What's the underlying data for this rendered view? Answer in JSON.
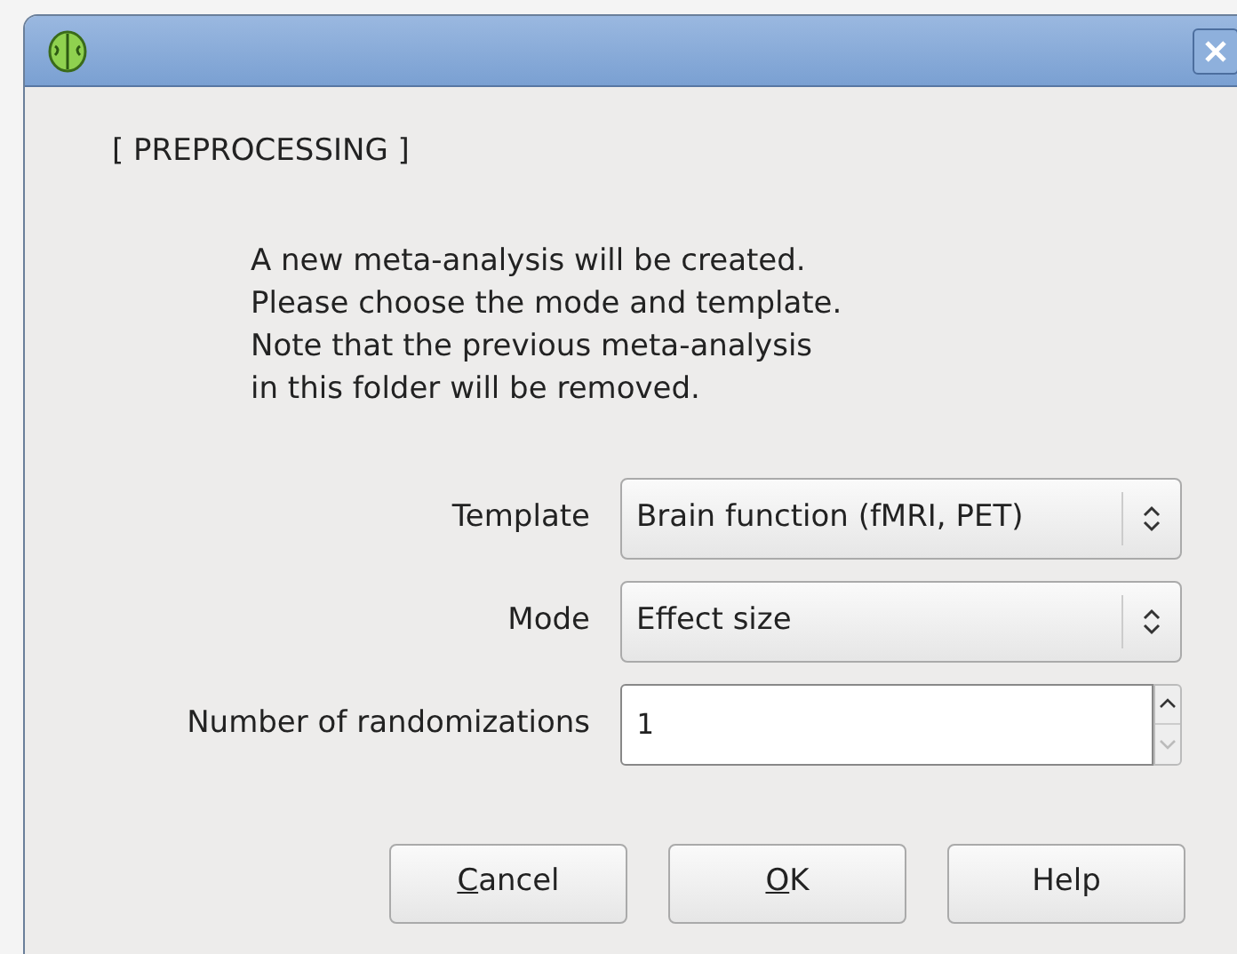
{
  "heading": "[ PREPROCESSING ]",
  "message": [
    "A new meta-analysis will be created.",
    "Please choose the mode and template.",
    "Note that the previous meta-analysis",
    "in this folder will be removed."
  ],
  "fields": [
    {
      "kind": "combo",
      "label": "Template",
      "value": "Brain function (fMRI, PET)"
    },
    {
      "kind": "combo",
      "label": "Mode",
      "value": "Effect size"
    },
    {
      "kind": "spin",
      "label": "Number of randomizations",
      "value": "1",
      "down_disabled": true
    }
  ],
  "buttons": [
    {
      "label": "Cancel",
      "underline_first": true
    },
    {
      "label": "OK",
      "underline_first": true
    },
    {
      "label": "Help",
      "underline_first": false
    }
  ]
}
